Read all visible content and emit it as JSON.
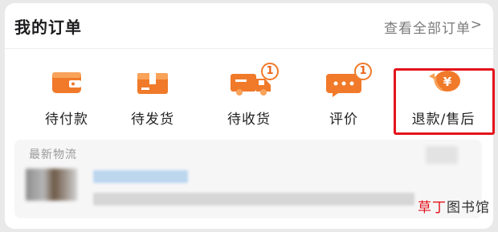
{
  "header": {
    "title": "我的订单",
    "view_all": "查看全部订单",
    "chevron": ">"
  },
  "orders": [
    {
      "label": "待付款",
      "icon": "wallet-icon",
      "badge": null
    },
    {
      "label": "待发货",
      "icon": "package-icon",
      "badge": null
    },
    {
      "label": "待收货",
      "icon": "delivery-truck-icon",
      "badge": "1"
    },
    {
      "label": "评价",
      "icon": "comment-icon",
      "badge": "1"
    },
    {
      "label": "退款/售后",
      "icon": "refund-icon",
      "badge": null
    }
  ],
  "logistics": {
    "title": "最新物流"
  },
  "watermark": {
    "accent": "草丁",
    "rest": "图书馆"
  },
  "colors": {
    "accent": "#f07a2a",
    "highlight_border": "#e3141b"
  }
}
